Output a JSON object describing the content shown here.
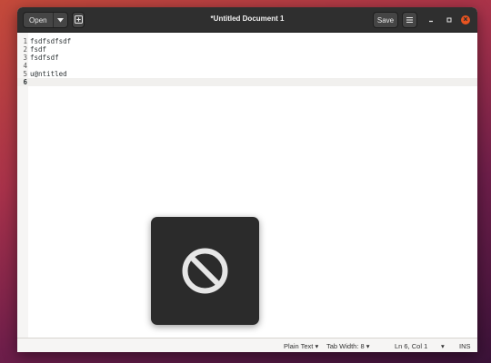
{
  "window": {
    "title": "*Untitled Document 1"
  },
  "headerbar": {
    "open_label": "Open",
    "open_caret_icon": "chevron-down-icon",
    "new_document_icon": "new-document-icon",
    "save_label": "Save",
    "menu_icon": "hamburger-menu-icon",
    "minimize_icon": "minimize-icon",
    "maximize_icon": "maximize-icon",
    "close_icon": "close-icon"
  },
  "editor": {
    "lines": [
      {
        "number": "1",
        "text": "fsdfsdfsdf"
      },
      {
        "number": "2",
        "text": "fsdf"
      },
      {
        "number": "3",
        "text": "fsdfsdf"
      },
      {
        "number": "4",
        "text": ""
      },
      {
        "number": "5",
        "text": "u@ntitled"
      },
      {
        "number": "6",
        "text": ""
      }
    ],
    "current_line": 6
  },
  "statusbar": {
    "language": "Plain Text",
    "language_caret": "▾",
    "tab_width": "Tab Width: 8",
    "tab_width_caret": "▾",
    "position": "Ln 6, Col 1",
    "position_caret": "▾",
    "mode": "INS"
  },
  "osd": {
    "icon": "no-entry-icon"
  },
  "colors": {
    "headerbar": "#2f2f2f",
    "close_button": "#e95420",
    "osd_background": "#2b2b2b"
  }
}
